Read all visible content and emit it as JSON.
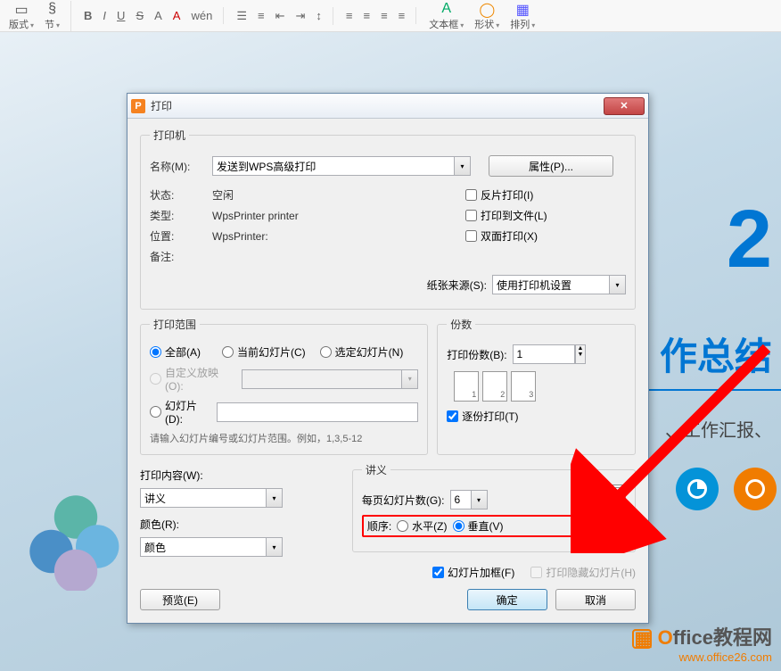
{
  "toolbar": {
    "format": "版式",
    "section": "节",
    "textbox": "文本框",
    "shape": "形状",
    "arrange": "排列",
    "bold": "B",
    "italic": "I",
    "underline": "U",
    "strike": "S",
    "super": "A",
    "highlight": "A",
    "script": "wén"
  },
  "slide": {
    "bigText": "2",
    "subtitle": "作总结",
    "caption": "、工作汇报、"
  },
  "dialog": {
    "title": "打印",
    "printer": {
      "legend": "打印机",
      "nameLabel": "名称(M):",
      "nameValue": "发送到WPS高级打印",
      "propsBtn": "属性(P)...",
      "statusLabel": "状态:",
      "statusValue": "空闲",
      "typeLabel": "类型:",
      "typeValue": "WpsPrinter printer",
      "locLabel": "位置:",
      "locValue": "WpsPrinter:",
      "commentLabel": "备注:",
      "reverse": "反片打印(I)",
      "toFile": "打印到文件(L)",
      "duplex": "双面打印(X)",
      "paperLabel": "纸张来源(S):",
      "paperValue": "使用打印机设置"
    },
    "range": {
      "legend": "打印范围",
      "all": "全部(A)",
      "current": "当前幻灯片(C)",
      "selected": "选定幻灯片(N)",
      "custom": "自定义放映(O):",
      "slides": "幻灯片(D):",
      "hint": "请输入幻灯片编号或幻灯片范围。例如，1,3,5-12"
    },
    "copies": {
      "legend": "份数",
      "countLabel": "打印份数(B):",
      "countValue": "1",
      "collate": "逐份打印(T)"
    },
    "content": {
      "label": "打印内容(W):",
      "value": "讲义",
      "colorLabel": "颜色(R):",
      "colorValue": "颜色"
    },
    "handout": {
      "legend": "讲义",
      "perPage": "每页幻灯片数(G):",
      "perPageValue": "6",
      "orderLabel": "顺序:",
      "horiz": "水平(Z)",
      "vert": "垂直(V)",
      "frame": "幻灯片加框(F)",
      "hidden": "打印隐藏幻灯片(H)"
    },
    "preview": "预览(E)",
    "ok": "确定",
    "cancel": "取消"
  },
  "watermark": {
    "brand": "Office教程网",
    "url": "www.office26.com"
  }
}
